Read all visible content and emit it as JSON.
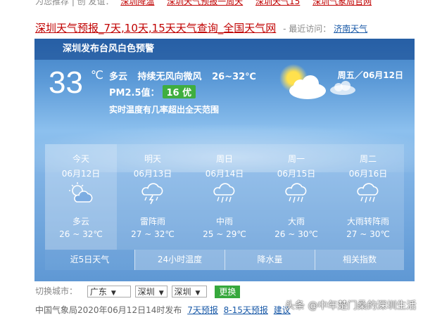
{
  "top_links": {
    "prefix": "为您推荐 | 创 友谊：",
    "items": [
      "深圳降温",
      "深圳天气预报一周天",
      "深圳天气15",
      "深圳气象局官网"
    ]
  },
  "title": {
    "main": "深圳天气预报_7天,10天,15天天气查询_全国天气网",
    "recent_label": "- 最近访问：",
    "recent_city": "济南天气"
  },
  "alert": "深圳发布台风白色预警",
  "current": {
    "temp": "33",
    "unit": "℃",
    "condition": "多云",
    "wind": "持续无风向微风",
    "range": "26~32℃",
    "pm_label": "PM2.5值：",
    "pm_badge": "16 优",
    "note": "实时温度有几率超出全天范围",
    "date": "周五／06月12日"
  },
  "forecast": [
    {
      "name": "今天",
      "date": "06月12日",
      "icon": "partly-cloudy-icon",
      "desc": "多云",
      "range": "26 ~ 32℃"
    },
    {
      "name": "明天",
      "date": "06月13日",
      "icon": "thunder-shower-icon",
      "desc": "雷阵雨",
      "range": "27 ~ 32℃"
    },
    {
      "name": "周日",
      "date": "06月14日",
      "icon": "rain-icon",
      "desc": "中雨",
      "range": "25 ~ 29℃"
    },
    {
      "name": "周一",
      "date": "06月15日",
      "icon": "rain-icon",
      "desc": "大雨",
      "range": "26 ~ 30℃"
    },
    {
      "name": "周二",
      "date": "06月16日",
      "icon": "rain-icon",
      "desc": "大雨转阵雨",
      "range": "27 ~ 30℃"
    }
  ],
  "tabs": [
    "近5日天气",
    "24小时温度",
    "降水量",
    "相关指数"
  ],
  "switch": {
    "label": "切换城市：",
    "province": "广东",
    "city": "深圳",
    "district": "深圳",
    "button": "更换"
  },
  "footer": {
    "text": "中国气象局2020年06月12日14时发布",
    "links": [
      "7天预报",
      "8-15天预报",
      "建议"
    ]
  },
  "watermark": "头条 @中年楚门桑的深圳生活"
}
